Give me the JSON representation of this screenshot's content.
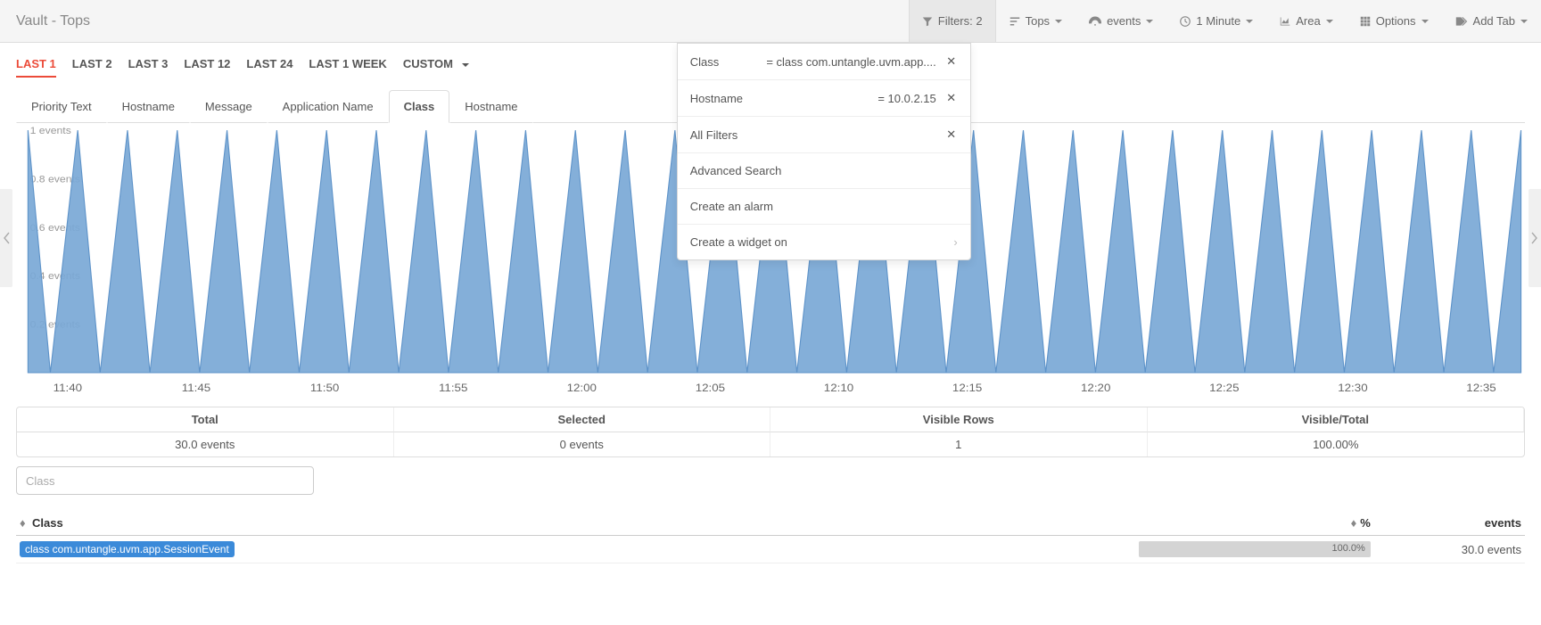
{
  "title": "Vault - Tops",
  "toolbar": {
    "filters_label": "Filters: 2",
    "tops_label": "Tops",
    "events_label": "events",
    "interval_label": "1 Minute",
    "chart_type_label": "Area",
    "options_label": "Options",
    "add_tab_label": "Add Tab"
  },
  "dropdown": {
    "filters": [
      {
        "name": "Class",
        "value": "= class com.untangle.uvm.app...."
      },
      {
        "name": "Hostname",
        "value": "= 10.0.2.15"
      }
    ],
    "all_filters_label": "All Filters",
    "advanced_search_label": "Advanced Search",
    "create_alarm_label": "Create an alarm",
    "create_widget_label": "Create a widget on"
  },
  "time_tabs": [
    "LAST 1",
    "LAST 2",
    "LAST 3",
    "LAST 12",
    "LAST 24",
    "LAST 1 WEEK",
    "CUSTOM"
  ],
  "time_tab_active": 0,
  "field_tabs": [
    "Priority Text",
    "Hostname",
    "Message",
    "Application Name",
    "Class",
    "Hostname"
  ],
  "field_tab_active": 4,
  "chart": {
    "y_ticks": [
      "0.2 events",
      "0.4 events",
      "0.6 events",
      "0.8 events",
      "1 events"
    ],
    "x_ticks": [
      "11:40",
      "11:45",
      "11:50",
      "11:55",
      "12:00",
      "12:05",
      "12:10",
      "12:15",
      "12:20",
      "12:25",
      "12:30",
      "12:35"
    ],
    "spikes": 30,
    "ymax": 1
  },
  "stats": {
    "headers": [
      "Total",
      "Selected",
      "Visible Rows",
      "Visible/Total"
    ],
    "values": [
      "30.0 events",
      "0 events",
      "1",
      "100.00%"
    ]
  },
  "filter_placeholder": "Class",
  "table": {
    "col_class": "Class",
    "col_pct": "%",
    "col_events": "events",
    "rows": [
      {
        "class": "class com.untangle.uvm.app.SessionEvent",
        "pct": "100.0%",
        "pct_num": 100,
        "events": "30.0 events"
      }
    ]
  }
}
